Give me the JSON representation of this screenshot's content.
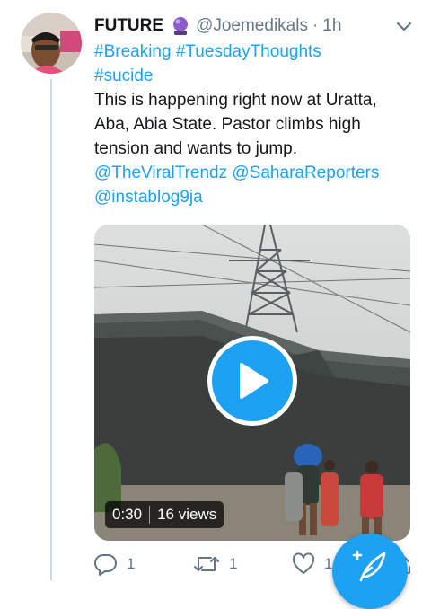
{
  "tweet": {
    "author_name": "FUTURE",
    "handle": "@Joemedikals",
    "separator": "·",
    "time": "1h",
    "lines": [
      {
        "parts": [
          {
            "text": "#Breaking",
            "link": true
          },
          {
            "text": " ",
            "link": false
          },
          {
            "text": "#TuesdayThoughts",
            "link": true
          }
        ]
      },
      {
        "parts": [
          {
            "text": "#sucide",
            "link": true
          }
        ]
      },
      {
        "parts": [
          {
            "text": "This is happening right now at Uratta,",
            "link": false
          }
        ]
      },
      {
        "parts": [
          {
            "text": "Aba, Abia State. Pastor climbs high",
            "link": false
          }
        ]
      },
      {
        "parts": [
          {
            "text": "tension and wants to jump.",
            "link": false
          }
        ]
      },
      {
        "parts": [
          {
            "text": "@TheViralTrendz",
            "link": true
          },
          {
            "text": " ",
            "link": false
          },
          {
            "text": "@SaharaReporters",
            "link": true
          }
        ]
      },
      {
        "parts": [
          {
            "text": "@instablog9ja",
            "link": true
          }
        ]
      }
    ]
  },
  "media": {
    "duration": "0:30",
    "views": "16 views",
    "play_icon": "play-icon"
  },
  "actions": {
    "reply_count": "1",
    "retweet_count": "1",
    "like_count": "1"
  },
  "colors": {
    "accent": "#1da1f2",
    "secondary_text": "#657786",
    "primary_text": "#14171a"
  },
  "icons": [
    "crystal-ball-icon",
    "chevron-down-icon",
    "reply-icon",
    "retweet-icon",
    "like-icon",
    "share-icon",
    "compose-feather-icon"
  ]
}
